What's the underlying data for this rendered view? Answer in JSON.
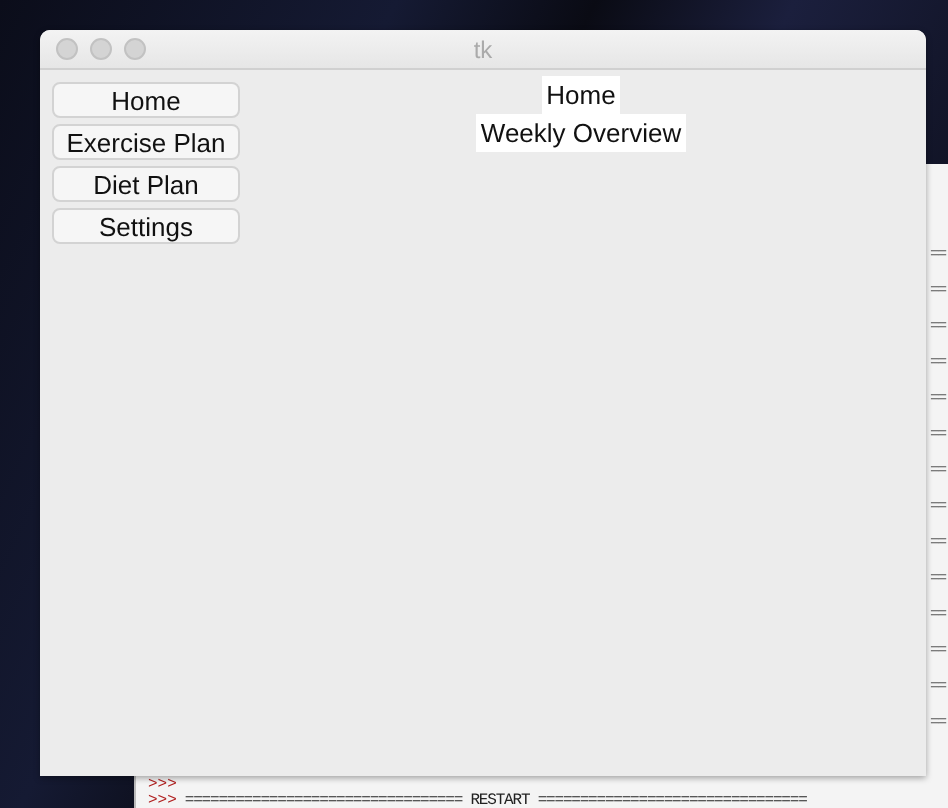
{
  "window": {
    "title": "tk"
  },
  "nav_buttons": [
    "Home",
    "Exercise Plan",
    "Diet Plan",
    "Settings"
  ],
  "labels": [
    "Home",
    "Weekly Overview"
  ],
  "shell": {
    "edge_lines": [
      "==",
      "==",
      "==",
      "==",
      "==",
      "==",
      "==",
      "==",
      "==",
      "==",
      "==",
      "==",
      "==",
      "=="
    ],
    "lines": [
      {
        "prompt": ">>>"
      },
      {
        "prompt": ">>>",
        "text": "================================= RESTART ================================"
      }
    ]
  }
}
